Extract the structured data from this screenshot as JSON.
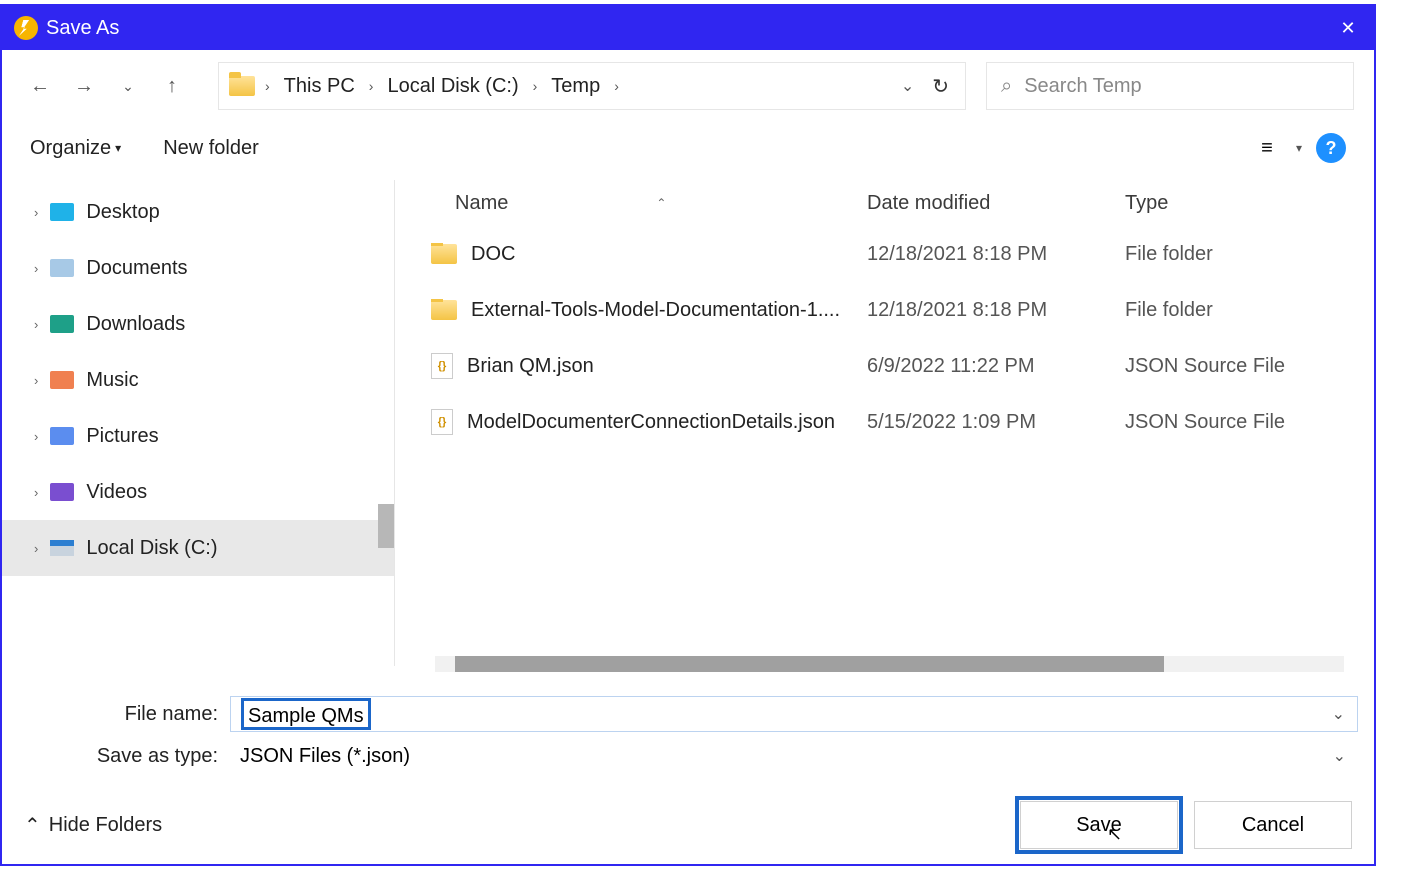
{
  "window": {
    "title": "Save As"
  },
  "nav": {
    "breadcrumbs": [
      "This PC",
      "Local Disk (C:)",
      "Temp"
    ]
  },
  "search": {
    "placeholder": "Search Temp"
  },
  "toolbar": {
    "organize": "Organize",
    "new_folder": "New folder"
  },
  "columns": {
    "name": "Name",
    "date": "Date modified",
    "type": "Type"
  },
  "sidebar": {
    "items": [
      {
        "label": "Desktop"
      },
      {
        "label": "Documents"
      },
      {
        "label": "Downloads"
      },
      {
        "label": "Music"
      },
      {
        "label": "Pictures"
      },
      {
        "label": "Videos"
      },
      {
        "label": "Local Disk (C:)"
      }
    ]
  },
  "files": [
    {
      "name": "DOC",
      "date": "12/18/2021 8:18 PM",
      "type": "File folder",
      "kind": "folder"
    },
    {
      "name": "External-Tools-Model-Documentation-1....",
      "date": "12/18/2021 8:18 PM",
      "type": "File folder",
      "kind": "folder"
    },
    {
      "name": "Brian QM.json",
      "date": "6/9/2022 11:22 PM",
      "type": "JSON Source File",
      "kind": "json"
    },
    {
      "name": "ModelDocumenterConnectionDetails.json",
      "date": "5/15/2022 1:09 PM",
      "type": "JSON Source File",
      "kind": "json"
    }
  ],
  "fields": {
    "file_name_label": "File name:",
    "file_name_value": "Sample QMs",
    "save_type_label": "Save as type:",
    "save_type_value": "JSON Files (*.json)"
  },
  "footer": {
    "hide_folders": "Hide Folders",
    "save": "Save",
    "cancel": "Cancel"
  }
}
